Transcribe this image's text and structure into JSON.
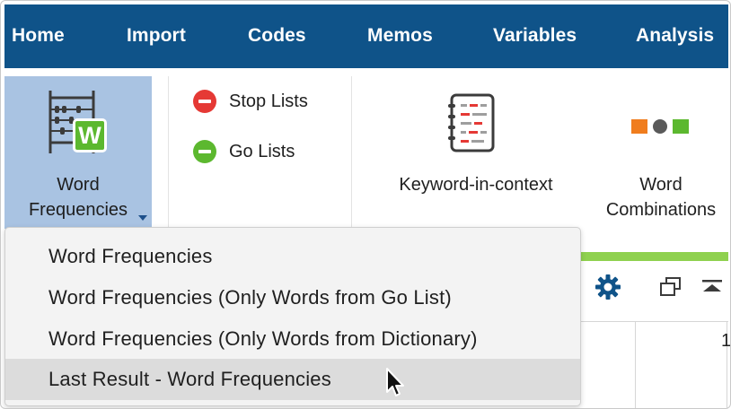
{
  "menubar": {
    "items": [
      "Home",
      "Import",
      "Codes",
      "Memos",
      "Variables",
      "Analysis"
    ]
  },
  "ribbon": {
    "word_frequencies": {
      "line1": "Word",
      "line2": "Frequencies",
      "icon": "abacus-icon",
      "badge": "W"
    },
    "stop_lists": {
      "label": "Stop Lists",
      "icon": "minus-circle-icon",
      "color": "#e53935"
    },
    "go_lists": {
      "label": "Go Lists",
      "icon": "minus-circle-icon",
      "color": "#5cb82f"
    },
    "keyword_in_context": {
      "label": "Keyword-in-context",
      "icon": "notebook-icon"
    },
    "word_combinations": {
      "line1": "Word",
      "line2": "Combinations",
      "icon": "shapes-icon"
    }
  },
  "dropdown": {
    "items": [
      {
        "label": "Word Frequencies"
      },
      {
        "label": "Word Frequencies (Only Words from Go List)"
      },
      {
        "label": "Word Frequencies (Only Words from Dictionary)"
      },
      {
        "label": "Last Result - Word Frequencies",
        "highlighted": true
      }
    ]
  },
  "background": {
    "toolbar_icons": [
      "gear-icon",
      "window-restore-icon",
      "collapse-up-icon"
    ],
    "column_header_partial": "1"
  },
  "colors": {
    "menubar": "#0f5389",
    "selected_tile": "#a9c3e2",
    "accent_green": "#8fd14f"
  }
}
